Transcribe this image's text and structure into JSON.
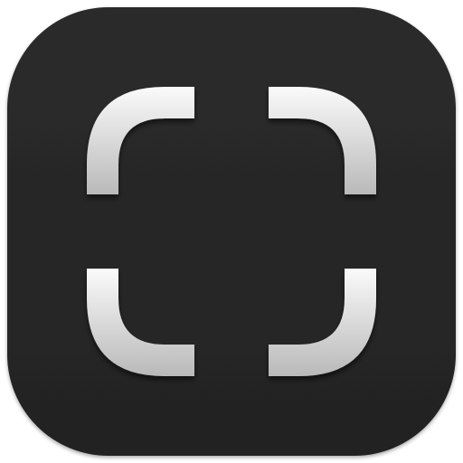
{
  "icon": {
    "name": "scan-frame-icon",
    "background_color": "#232323",
    "corner_light_color": "#fafafa",
    "corner_dark_color": "#b9b9b9"
  }
}
